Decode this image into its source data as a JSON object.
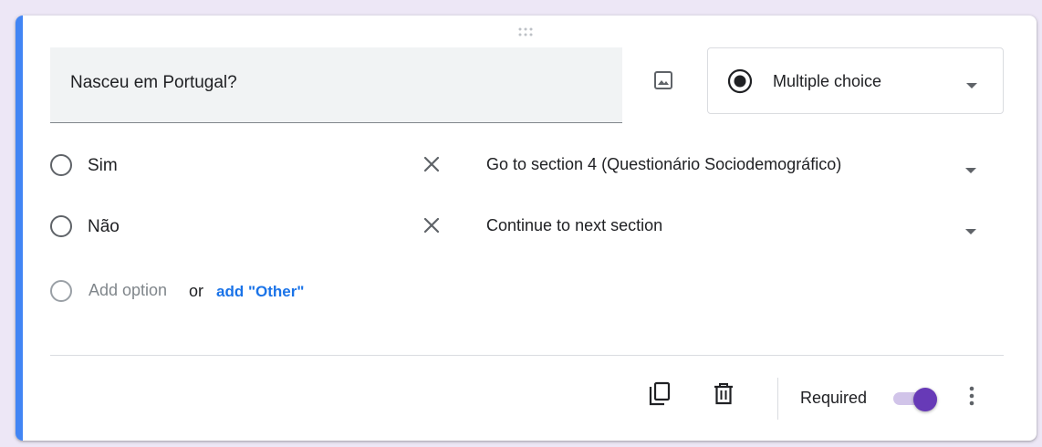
{
  "question": {
    "title": "Nasceu em Portugal?",
    "type_label": "Multiple choice"
  },
  "options": [
    {
      "label": "Sim",
      "goto": "Go to section 4 (Questionário Sociodemográfico)"
    },
    {
      "label": "Não",
      "goto": "Continue to next section"
    }
  ],
  "add_option": {
    "placeholder": "Add option",
    "or_text": "or",
    "other_link": "add \"Other\""
  },
  "footer": {
    "required_label": "Required",
    "required_on": true
  },
  "colors": {
    "accent": "#4285f4",
    "toggle_thumb": "#673ab7",
    "toggle_track": "#d1c4e9",
    "link": "#1a73e8",
    "background": "#ede7f6"
  },
  "icons": [
    "drag-handle-icon",
    "image-icon",
    "radio-checked-icon",
    "dropdown-arrow-icon",
    "close-icon",
    "duplicate-icon",
    "delete-icon",
    "more-vert-icon"
  ]
}
